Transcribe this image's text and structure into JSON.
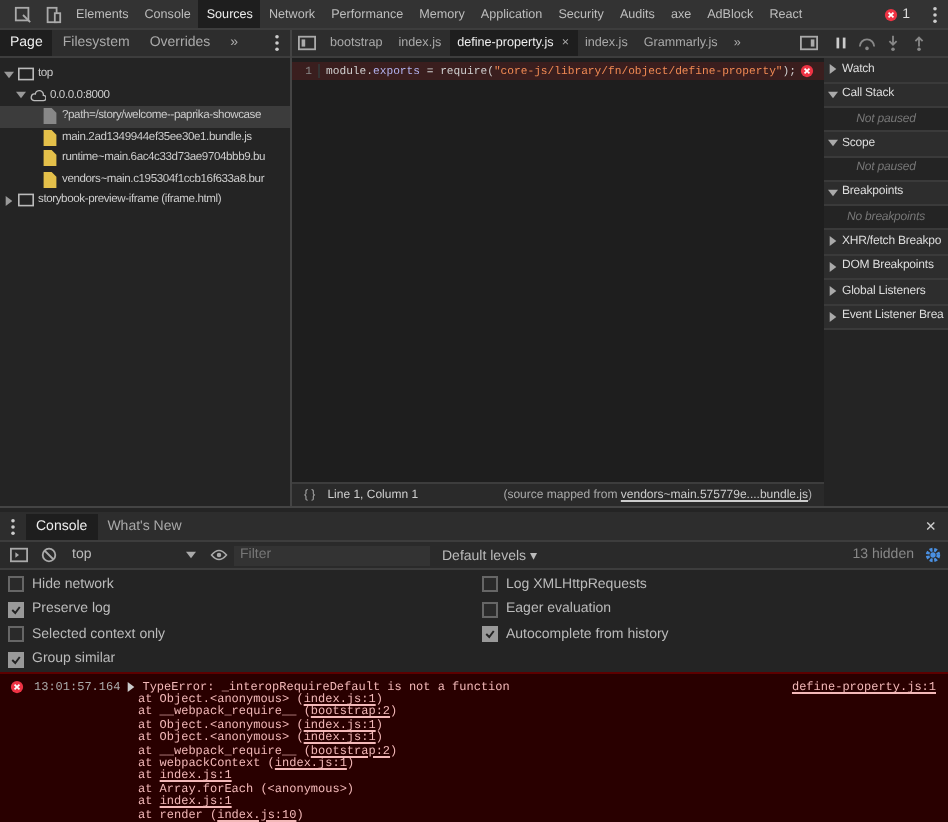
{
  "main_tabs": [
    {
      "label": "Elements",
      "selected": false
    },
    {
      "label": "Console",
      "selected": false
    },
    {
      "label": "Sources",
      "selected": true
    },
    {
      "label": "Network",
      "selected": false
    },
    {
      "label": "Performance",
      "selected": false
    },
    {
      "label": "Memory",
      "selected": false
    },
    {
      "label": "Application",
      "selected": false
    },
    {
      "label": "Security",
      "selected": false
    },
    {
      "label": "Audits",
      "selected": false
    },
    {
      "label": "axe",
      "selected": false
    },
    {
      "label": "AdBlock",
      "selected": false
    },
    {
      "label": "React",
      "selected": false
    }
  ],
  "error_count": "1",
  "navigator": {
    "tabs": [
      {
        "label": "Page",
        "selected": true
      },
      {
        "label": "Filesystem",
        "selected": false
      },
      {
        "label": "Overrides",
        "selected": false
      }
    ],
    "more": "»",
    "tree": [
      {
        "kind": "frame",
        "label": "top",
        "expanded": true,
        "selected": false,
        "children": [
          {
            "kind": "origin",
            "label": "0.0.0.0:8000",
            "expanded": true,
            "selected": false,
            "children": [
              {
                "kind": "document",
                "label": "?path=/story/welcome--paprika-showcase",
                "selected": true
              },
              {
                "kind": "script",
                "label": "main.2ad1349944ef35ee30e1.bundle.js",
                "selected": false
              },
              {
                "kind": "script",
                "label": "runtime~main.6ac4c33d73ae9704bbb9.bu",
                "selected": false
              },
              {
                "kind": "script",
                "label": "vendors~main.c195304f1ccb16f633a8.bur",
                "selected": false
              }
            ]
          }
        ]
      },
      {
        "kind": "frame",
        "label": "storybook-preview-iframe (iframe.html)",
        "expanded": false,
        "selected": false
      }
    ]
  },
  "editor": {
    "tabs": [
      {
        "label": "bootstrap",
        "selected": false
      },
      {
        "label": "index.js",
        "selected": false
      },
      {
        "label": "define-property.js",
        "selected": true,
        "close": "×"
      },
      {
        "label": "index.js",
        "selected": false
      },
      {
        "label": "Grammarly.js",
        "selected": false
      }
    ],
    "more": "»",
    "lines": [
      {
        "number": "1",
        "error": true,
        "tokens": [
          {
            "kind": "plain",
            "text": "module."
          },
          {
            "kind": "property",
            "text": "exports"
          },
          {
            "kind": "plain",
            "text": " = require("
          },
          {
            "kind": "string",
            "text": "\"core-js/library/fn/object/define-property\""
          },
          {
            "kind": "plain",
            "text": ");"
          }
        ]
      }
    ],
    "status": {
      "format": "{ }",
      "position": "Line 1, Column 1",
      "source_before": "(source mapped from ",
      "source_link": "vendors~main.575779e....bundle.js",
      "source_after": ")"
    }
  },
  "debugger": {
    "sections": [
      {
        "title": "Watch",
        "expanded": false
      },
      {
        "title": "Call Stack",
        "expanded": true,
        "message": "Not paused"
      },
      {
        "title": "Scope",
        "expanded": true,
        "message": "Not paused"
      },
      {
        "title": "Breakpoints",
        "expanded": true,
        "message": "No breakpoints"
      },
      {
        "title": "XHR/fetch Breakpo",
        "expanded": false
      },
      {
        "title": "DOM Breakpoints",
        "expanded": false
      },
      {
        "title": "Global Listeners",
        "expanded": false
      },
      {
        "title": "Event Listener Brea",
        "expanded": false
      }
    ]
  },
  "drawer": {
    "tabs": [
      {
        "label": "Console",
        "selected": true
      },
      {
        "label": "What's New",
        "selected": false
      }
    ],
    "close": "×"
  },
  "console_toolbar": {
    "context": "top",
    "filter_placeholder": "Filter",
    "levels": "Default levels ▾",
    "hidden": "13 hidden"
  },
  "settings": [
    [
      {
        "label": "Hide network",
        "checked": false
      },
      {
        "label": "Preserve log",
        "checked": true
      },
      {
        "label": "Selected context only",
        "checked": false
      },
      {
        "label": "Group similar",
        "checked": true
      }
    ],
    [
      {
        "label": "Log XMLHttpRequests",
        "checked": false
      },
      {
        "label": "Eager evaluation",
        "checked": false
      },
      {
        "label": "Autocomplete from history",
        "checked": true
      }
    ]
  ],
  "error": {
    "time": "13:01:57.164",
    "message": "TypeError: _interopRequireDefault is not a function",
    "source": "define-property.js:1",
    "stack": [
      {
        "before": "at Object.<anonymous> (",
        "link": "index.js:1",
        "after": ")"
      },
      {
        "before": "at __webpack_require__ (",
        "link": "bootstrap:2",
        "after": ")"
      },
      {
        "before": "at Object.<anonymous> (",
        "link": "index.js:1",
        "after": ")"
      },
      {
        "before": "at Object.<anonymous> (",
        "link": "index.js:1",
        "after": ")"
      },
      {
        "before": "at __webpack_require__ (",
        "link": "bootstrap:2",
        "after": ")"
      },
      {
        "before": "at webpackContext (",
        "link": "index.js:1",
        "after": ")"
      },
      {
        "before": "at ",
        "link": "index.js:1"
      },
      {
        "before": "at Array.forEach (<anonymous>)"
      },
      {
        "before": "at ",
        "link": "index.js:1"
      },
      {
        "before": "at render (",
        "link": "index.js:10",
        "after": ")"
      }
    ]
  }
}
